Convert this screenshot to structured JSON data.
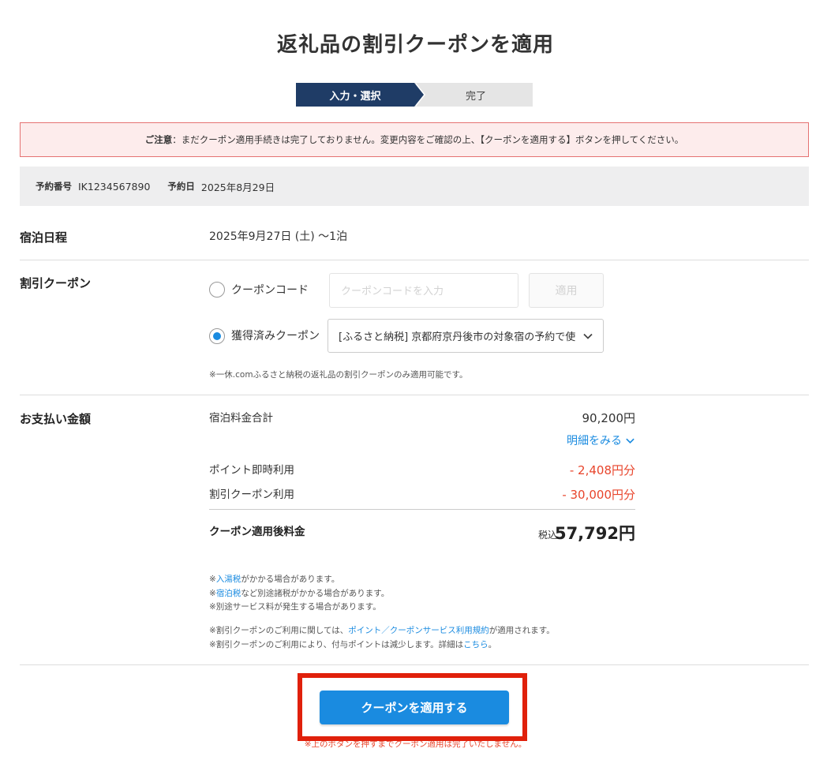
{
  "page": {
    "title": "返礼品の割引クーポンを適用"
  },
  "steps": [
    {
      "label": "入力・選択",
      "active": true
    },
    {
      "label": "完了",
      "active": false
    }
  ],
  "notice": {
    "label": "ご注意",
    "text": "：まだクーポン適用手続きは完了しておりません。変更内容をご確認の上、【クーポンを適用する】ボタンを押してください。"
  },
  "reservation": {
    "number_label": "予約番号",
    "number": "IK1234567890",
    "date_label": "予約日",
    "date": "2025年8月29日"
  },
  "stay": {
    "label": "宿泊日程",
    "value": "2025年9月27日 (土) 〜1泊"
  },
  "coupon": {
    "label": "割引クーポン",
    "code_option_label": "クーポンコード",
    "code_placeholder": "クーポンコードを入力",
    "apply_label": "適用",
    "acquired_option_label": "獲得済みクーポン",
    "selected_coupon": "[ふるさと納税] 京都府京丹後市の対象宿の予約で使",
    "selected_option": "acquired",
    "note": "※一休.comふるさと納税の返礼品の割引クーポンのみ適用可能です。"
  },
  "payment": {
    "label": "お支払い金額",
    "subtotal_label": "宿泊料金合計",
    "subtotal": "90,200円",
    "detail_link": "明細をみる",
    "points_label": "ポイント即時利用",
    "points": "- 2,408円分",
    "coupon_label": "割引クーポン利用",
    "coupon_discount": "- 30,000円分",
    "total_label": "クーポン適用後料金",
    "tax_label": "税込",
    "total": "57,792円"
  },
  "notes": {
    "line1_prefix": "※",
    "line1_link": "入湯税",
    "line1_suffix": "がかかる場合があります。",
    "line2_prefix": "※",
    "line2_link": "宿泊税",
    "line2_suffix": "など別途諸税がかかる場合があります。",
    "line3": "※別途サービス料が発生する場合があります。",
    "line4_prefix": "※割引クーポンのご利用に関しては、",
    "line4_link": "ポイント／クーポンサービス利用規約",
    "line4_suffix": "が適用されます。",
    "line5_prefix": "※割引クーポンのご利用により、付与ポイントは減少します。詳細は",
    "line5_link": "こちら",
    "line5_suffix": "。"
  },
  "cta": {
    "button_label": "クーポンを適用する",
    "warning": "※上のボタンを押すまでクーポン適用は完了いたしません。"
  },
  "colors": {
    "primary_blue": "#1a8be0",
    "step_navy": "#1f3c66",
    "discount_red": "#e8452c",
    "highlight_frame": "#e0200b",
    "notice_bg": "#fdecec"
  }
}
